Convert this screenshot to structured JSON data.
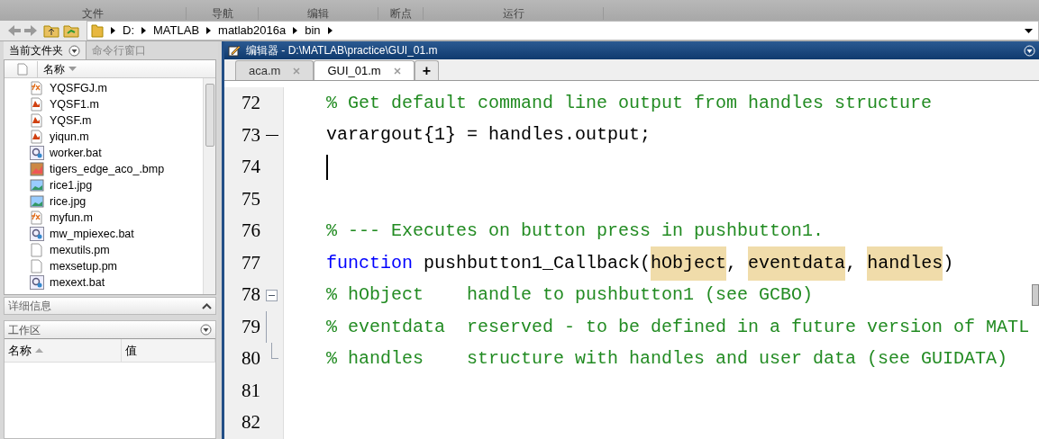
{
  "toolstrip_sections": [
    "文件",
    "导航",
    "编辑",
    "断点",
    "运行"
  ],
  "address_bar": {
    "path": [
      "D:",
      "MATLAB",
      "matlab2016a",
      "bin"
    ]
  },
  "left_panel": {
    "tabs": [
      {
        "label": "当前文件夹",
        "selected": true
      },
      {
        "label": "命令行窗口",
        "selected": false
      }
    ],
    "file_list": {
      "column": "名称",
      "files": [
        {
          "name": "YQSFGJ.m",
          "kind": "function"
        },
        {
          "name": "YQSF1.m",
          "kind": "script"
        },
        {
          "name": "YQSF.m",
          "kind": "script"
        },
        {
          "name": "yiqun.m",
          "kind": "script"
        },
        {
          "name": "worker.bat",
          "kind": "batch"
        },
        {
          "name": "tigers_edge_aco_.bmp",
          "kind": "bitmap"
        },
        {
          "name": "rice1.jpg",
          "kind": "image"
        },
        {
          "name": "rice.jpg",
          "kind": "image"
        },
        {
          "name": "myfun.m",
          "kind": "function"
        },
        {
          "name": "mw_mpiexec.bat",
          "kind": "batch"
        },
        {
          "name": "mexutils.pm",
          "kind": "plain"
        },
        {
          "name": "mexsetup.pm",
          "kind": "plain"
        },
        {
          "name": "mexext.bat",
          "kind": "batch"
        }
      ]
    },
    "details": {
      "title": "详细信息"
    },
    "workspace": {
      "title": "工作区",
      "columns": [
        "名称",
        "值"
      ]
    }
  },
  "editor": {
    "title": "编辑器 - D:\\MATLAB\\practice\\GUI_01.m",
    "tabs": [
      {
        "label": "aca.m",
        "selected": false
      },
      {
        "label": "GUI_01.m",
        "selected": true
      }
    ],
    "new_tab": "+",
    "lines": [
      {
        "number": "72",
        "kind": "plain",
        "segments": [
          {
            "kind": "comment",
            "text": "% Get default command line output from handles structure",
            "highlight": false
          }
        ]
      },
      {
        "number": "73",
        "kind": "dash",
        "segments": [
          {
            "kind": "plain",
            "text": "varargout{1} = handles.output;",
            "highlight": false
          }
        ]
      },
      {
        "number": "74",
        "kind": "plain",
        "cursor": true
      },
      {
        "number": "75",
        "kind": "plain"
      },
      {
        "number": "76",
        "kind": "plain",
        "segments": [
          {
            "kind": "comment",
            "text": "% --- Executes on button press in pushbutton1.",
            "highlight": false
          }
        ]
      },
      {
        "number": "77",
        "kind": "plain",
        "segments": [
          {
            "kind": "keyword",
            "text": "function",
            "highlight": false
          },
          {
            "kind": "plain",
            "text": " pushbutton1_Callback(",
            "highlight": false
          },
          {
            "kind": "plain",
            "text": "hObject",
            "highlight": true
          },
          {
            "kind": "plain",
            "text": ", ",
            "highlight": false
          },
          {
            "kind": "plain",
            "text": "eventdata",
            "highlight": true
          },
          {
            "kind": "plain",
            "text": ", ",
            "highlight": false
          },
          {
            "kind": "plain",
            "text": "handles",
            "highlight": true
          },
          {
            "kind": "plain",
            "text": ")",
            "highlight": false
          }
        ]
      },
      {
        "number": "78",
        "kind": "fold",
        "segments": [
          {
            "kind": "comment",
            "text": "% hObject    handle to pushbutton1 (see GCBO)",
            "highlight": false
          }
        ]
      },
      {
        "number": "79",
        "kind": "foldbody",
        "segments": [
          {
            "kind": "comment",
            "text": "% eventdata  reserved - to be defined in a future version of MATL",
            "highlight": false
          }
        ]
      },
      {
        "number": "80",
        "kind": "foldend",
        "segments": [
          {
            "kind": "comment",
            "text": "% handles    structure with handles and user data (see GUIDATA)",
            "highlight": false
          }
        ]
      },
      {
        "number": "81",
        "kind": "plain"
      },
      {
        "number": "82",
        "kind": "plain"
      }
    ]
  }
}
